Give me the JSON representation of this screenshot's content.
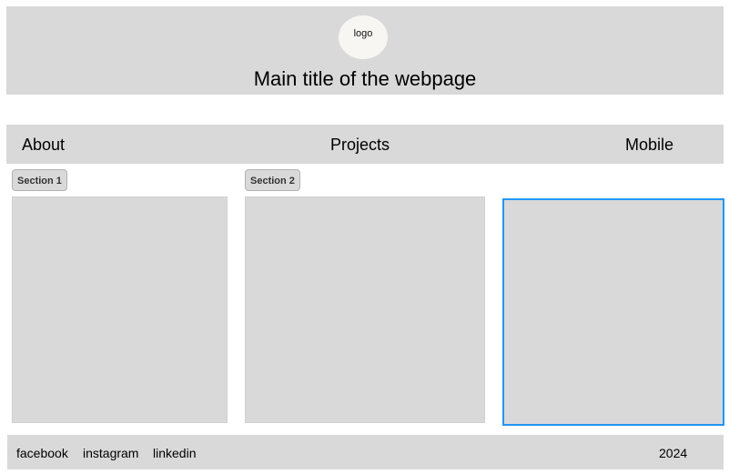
{
  "header": {
    "logo_text": "logo",
    "title": "Main title of the webpage"
  },
  "nav": {
    "items": [
      {
        "label": "About"
      },
      {
        "label": "Projects"
      },
      {
        "label": "Mobile"
      }
    ]
  },
  "sections": [
    {
      "label": "Section 1"
    },
    {
      "label": "Section 2"
    }
  ],
  "colors": {
    "surface": "#d9d9d9",
    "logo_bg": "#f7f6f3",
    "selected_border": "#2196f3"
  },
  "footer": {
    "links": [
      {
        "label": "facebook"
      },
      {
        "label": "instagram"
      },
      {
        "label": "linkedin"
      }
    ],
    "year": "2024"
  }
}
